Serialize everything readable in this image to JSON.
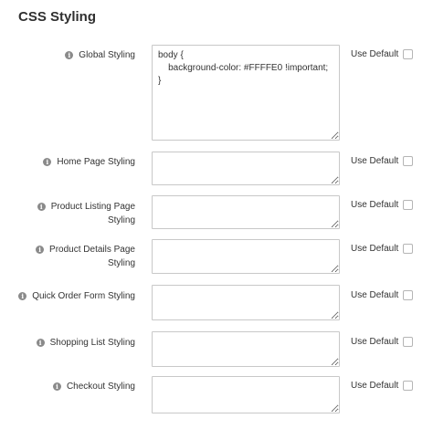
{
  "section": {
    "title": "CSS Styling"
  },
  "icon": {
    "info": "info-icon",
    "glyph": "i"
  },
  "use_default_label": "Use Default",
  "fields": [
    {
      "label_lines": [
        "Global Styling"
      ],
      "value": "body {\n    background-color: #FFFFE0 !important;\n}"
    },
    {
      "label_lines": [
        "Home Page Styling"
      ],
      "value": ""
    },
    {
      "label_lines": [
        "Product Listing Page",
        "Styling"
      ],
      "value": ""
    },
    {
      "label_lines": [
        "Product Details Page",
        "Styling"
      ],
      "value": ""
    },
    {
      "label_lines": [
        "Quick Order Form Styling"
      ],
      "value": ""
    },
    {
      "label_lines": [
        "Shopping List Styling"
      ],
      "value": ""
    },
    {
      "label_lines": [
        "Checkout Styling"
      ],
      "value": ""
    }
  ]
}
